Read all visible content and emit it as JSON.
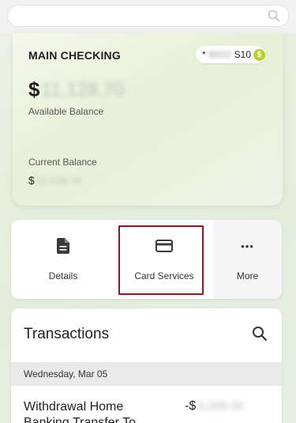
{
  "search": {
    "icon": "search-icon"
  },
  "account": {
    "title": "MAIN CHECKING",
    "number_prefix": "*",
    "number_suffix": "S10",
    "coin_glyph": "$",
    "currency": "$",
    "available_balance_masked": "11,128.70",
    "available_label": "Available Balance",
    "current_label": "Current Balance",
    "current_balance_masked": "11,128.70"
  },
  "actions": {
    "details_label": "Details",
    "card_services_label": "Card Services",
    "more_label": "More",
    "more_glyph": "•••"
  },
  "transactions": {
    "title": "Transactions",
    "date_header": "Wednesday, Mar 05",
    "rows": [
      {
        "description_line1": "Withdrawal Home",
        "description_line2": "Banking Transfer To",
        "amount_sign": "-$",
        "amount_masked": "3,008.00"
      }
    ]
  },
  "colors": {
    "highlight": "#8e1c1c",
    "coin": "#b9d02c"
  }
}
